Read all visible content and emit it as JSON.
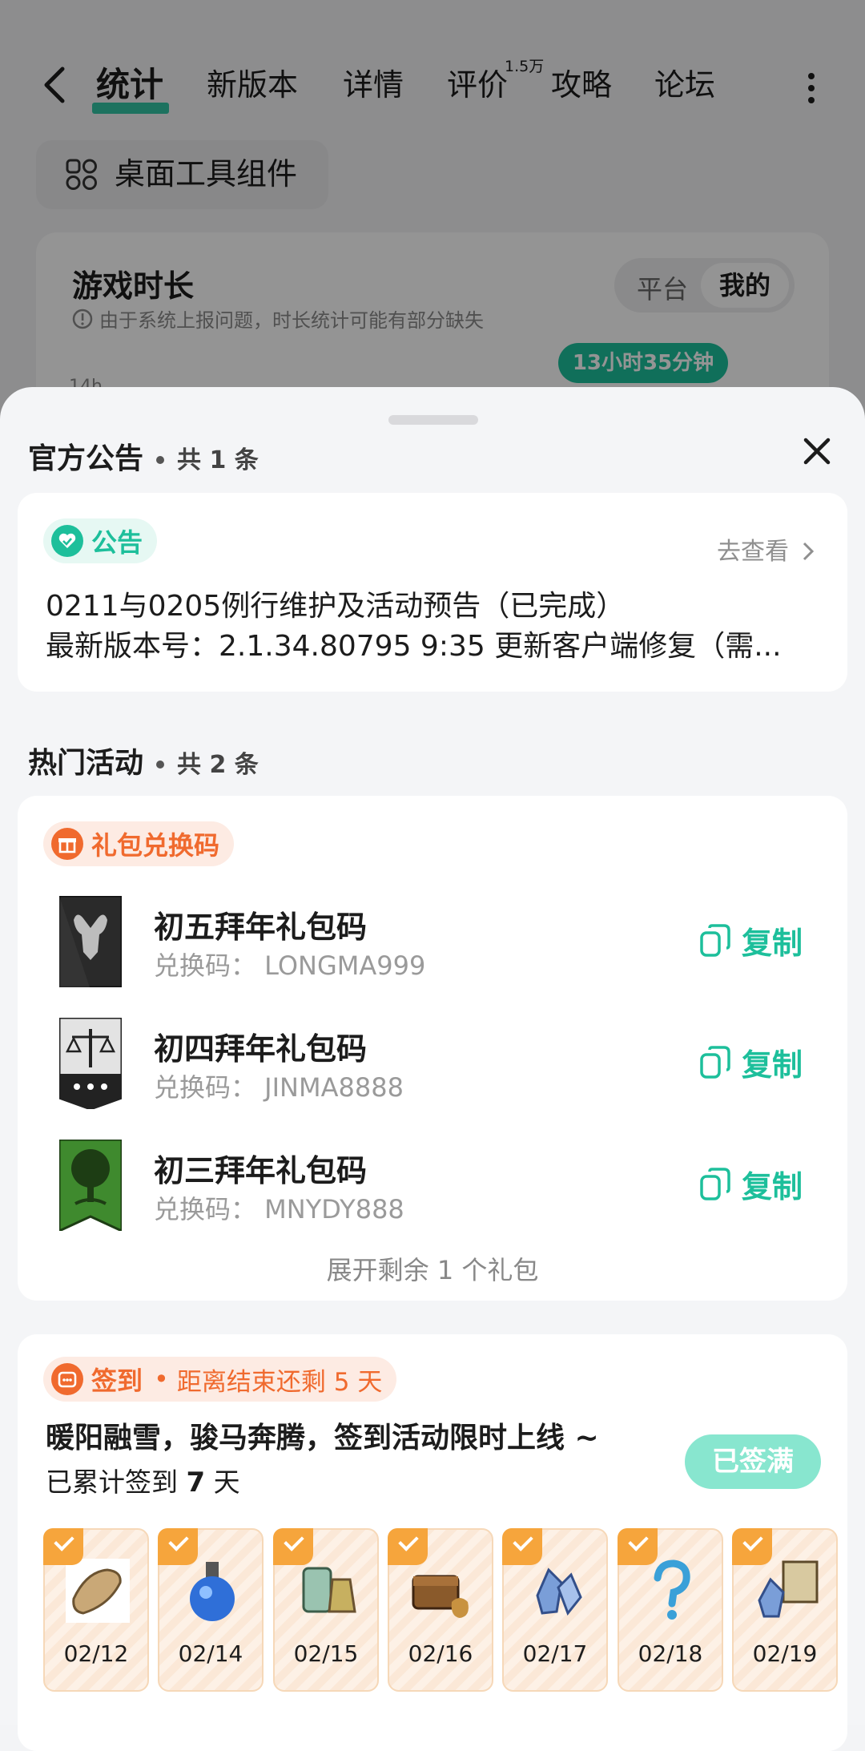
{
  "nav": {
    "tabs": [
      "统计",
      "新版本",
      "详情",
      "评价",
      "攻略",
      "论坛"
    ],
    "review_badge": "1.5万"
  },
  "widget_chip": {
    "label": "桌面工具组件"
  },
  "playtime_card": {
    "title": "游戏时长",
    "note": "由于系统上报问题，时长统计可能有部分缺失",
    "segment": [
      "平台",
      "我的"
    ],
    "total_time": "13小时35分钟",
    "axis_label": "14h"
  },
  "sheet": {
    "announcement_section": {
      "title": "官方公告",
      "count": "共 1 条"
    },
    "announcement": {
      "tag": "公告",
      "link": "去查看",
      "line1": "0211与0205例行维护及活动预告（已完成）",
      "line2": "最新版本号：2.1.34.80795 9:35 更新客户端修复（需..."
    },
    "activity_section": {
      "title": "热门活动",
      "count": "共 2 条"
    },
    "gift": {
      "tag": "礼包兑换码",
      "items": [
        {
          "name": "初五拜年礼包码",
          "code": "兑换码：  LONGMA999",
          "action": "复制"
        },
        {
          "name": "初四拜年礼包码",
          "code": "兑换码：  JINMA8888",
          "action": "复制"
        },
        {
          "name": "初三拜年礼包码",
          "code": "兑换码：  MNYDY888",
          "action": "复制"
        }
      ],
      "expand": "展开剩余 1 个礼包"
    },
    "checkin": {
      "tag": "签到",
      "remaining": "距离结束还剩 5 天",
      "title": "暖阳融雪，骏马奔腾，签到活动限时上线 ~",
      "total_prefix": "已累计签到",
      "total_days": "7",
      "total_suffix": "天",
      "button": "已签满",
      "days": [
        "02/12",
        "02/14",
        "02/15",
        "02/16",
        "02/17",
        "02/18",
        "02/19"
      ]
    }
  },
  "colors": {
    "accent": "#1dbf9b",
    "orange": "#f06a2e",
    "check": "#f6a53c"
  }
}
